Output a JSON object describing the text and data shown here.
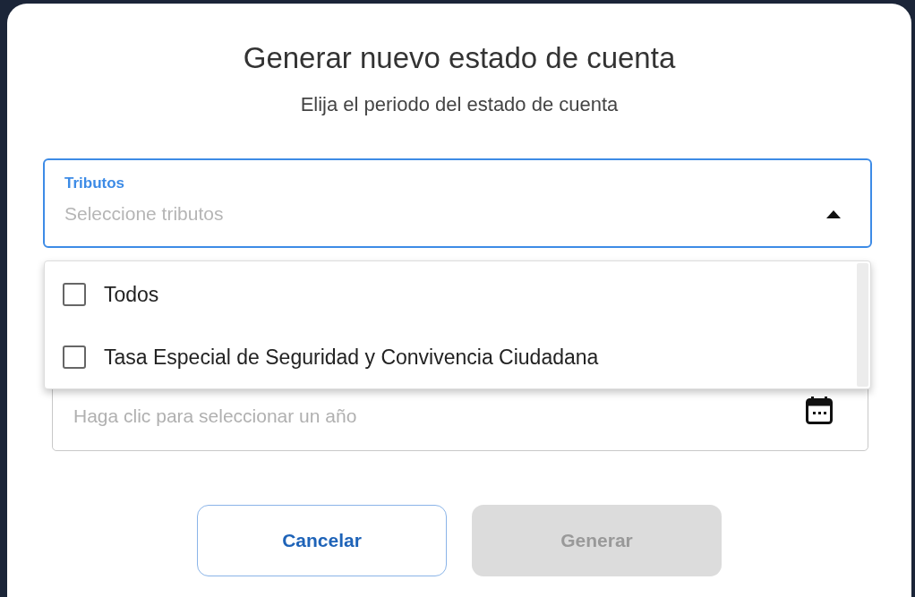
{
  "dialog": {
    "title": "Generar nuevo estado de cuenta",
    "subtitle": "Elija el periodo del estado de cuenta"
  },
  "tributos_field": {
    "label": "Tributos",
    "placeholder": "Seleccione tributos",
    "expanded": true
  },
  "tributos_options": [
    {
      "label": "Todos",
      "checked": false
    },
    {
      "label": "Tasa Especial de Seguridad y Convivencia Ciudadana",
      "checked": false
    }
  ],
  "year_field": {
    "placeholder": "Haga clic para seleccionar un año"
  },
  "buttons": [
    {
      "label": "Cancelar",
      "kind": "outline",
      "disabled": false
    },
    {
      "label": "Generar",
      "kind": "filled",
      "disabled": true
    }
  ]
}
